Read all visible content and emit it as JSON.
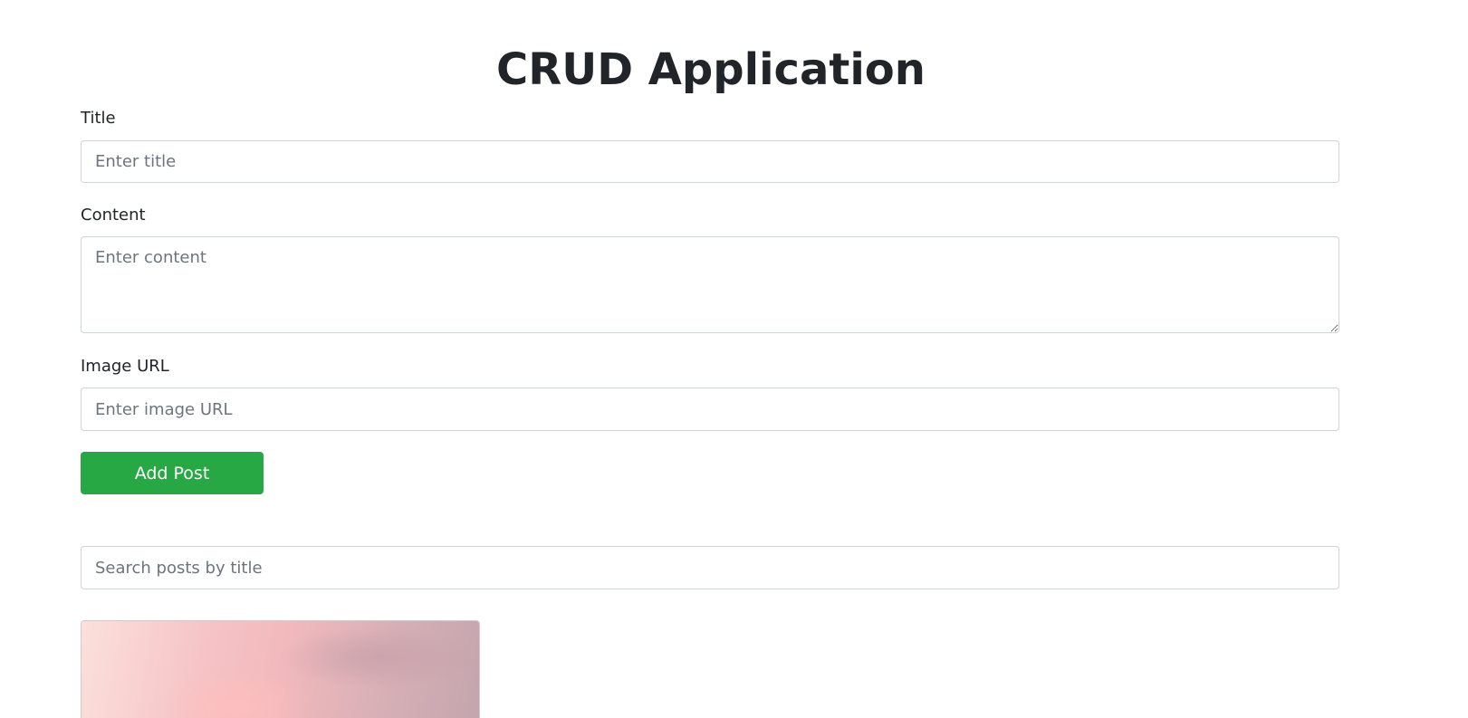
{
  "app": {
    "title": "CRUD Application"
  },
  "form": {
    "title_label": "Title",
    "title_placeholder": "Enter title",
    "title_value": "",
    "content_label": "Content",
    "content_placeholder": "Enter content",
    "content_value": "",
    "image_url_label": "Image URL",
    "image_url_placeholder": "Enter image URL",
    "image_url_value": "",
    "submit_label": "Add Post",
    "submit_color": "#28a745"
  },
  "search": {
    "placeholder": "Search posts by title",
    "value": ""
  },
  "posts": [
    {
      "image": "pink-sky-photo"
    }
  ]
}
